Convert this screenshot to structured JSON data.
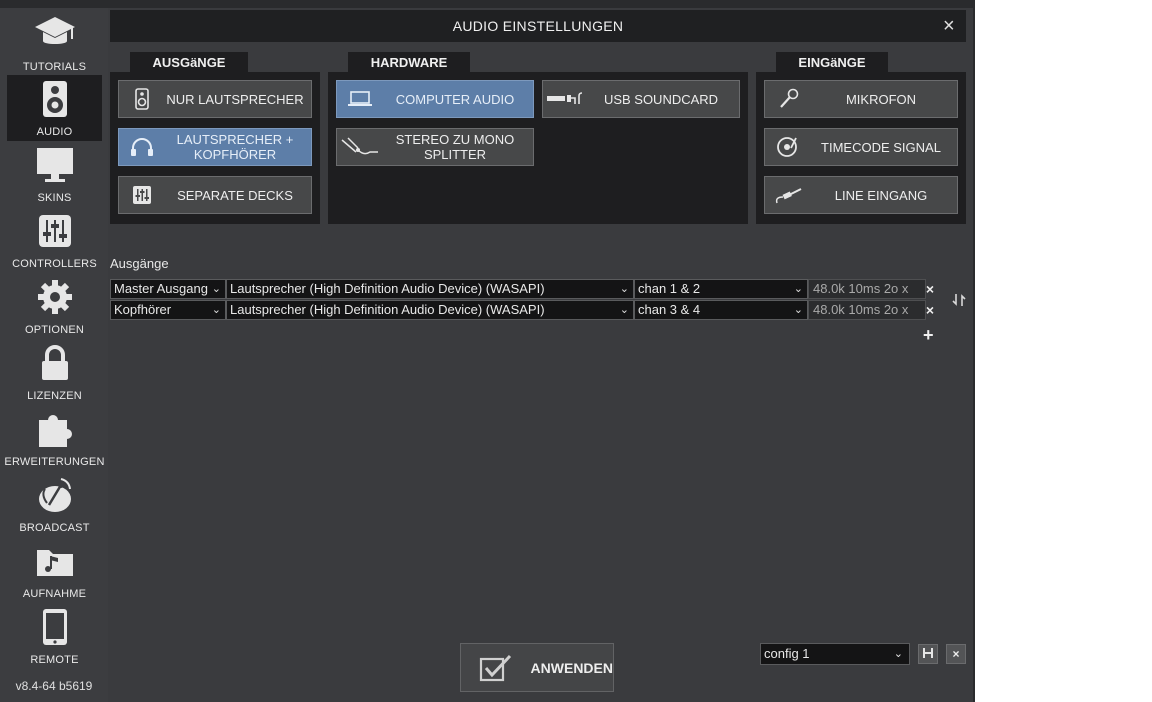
{
  "sidebar": {
    "items": [
      {
        "label": "TUTORIALS",
        "icon": "graduation-cap-icon"
      },
      {
        "label": "AUDIO",
        "icon": "speaker-icon",
        "active": true
      },
      {
        "label": "SKINS",
        "icon": "monitor-icon"
      },
      {
        "label": "CONTROLLERS",
        "icon": "sliders-icon"
      },
      {
        "label": "OPTIONEN",
        "icon": "gear-icon"
      },
      {
        "label": "LIZENZEN",
        "icon": "lock-icon"
      },
      {
        "label": "ERWEITERUNGEN",
        "icon": "puzzle-icon"
      },
      {
        "label": "BROADCAST",
        "icon": "satellite-dish-icon"
      },
      {
        "label": "AUFNAHME",
        "icon": "music-folder-icon"
      },
      {
        "label": "REMOTE",
        "icon": "phone-icon"
      }
    ],
    "version": "v8.4-64 b5619"
  },
  "dialog": {
    "title": "AUDIO EINSTELLUNGEN",
    "close": "×"
  },
  "outputs": {
    "tab": "AUSGäNGE",
    "buttons": {
      "speakers_only": "NUR LAUTSPRECHER",
      "speakers_headphones": "LAUTSPRECHER + KOPFHÖRER",
      "separate_decks": "SEPARATE DECKS"
    }
  },
  "hardware": {
    "tab": "HARDWARE",
    "buttons": {
      "computer_audio": "COMPUTER AUDIO",
      "usb_soundcard": "USB SOUNDCARD",
      "stereo_mono": "STEREO ZU MONO SPLITTER"
    }
  },
  "inputs": {
    "tab": "EINGäNGE",
    "buttons": {
      "microphone": "MIKROFON",
      "timecode": "TIMECODE SIGNAL",
      "line_in": "LINE EINGANG"
    }
  },
  "config_section": {
    "label": "Ausgänge",
    "rows": [
      {
        "output": "Master Ausgang",
        "device": "Lautsprecher (High Definition Audio Device) (WASAPI)",
        "channels": "chan 1 & 2",
        "info": "48.0k 10ms 2o x"
      },
      {
        "output": "Kopfhörer",
        "device": "Lautsprecher (High Definition Audio Device) (WASAPI)",
        "channels": "chan 3 & 4",
        "info": "48.0k 10ms 2o x"
      }
    ],
    "remove_symbol": "×",
    "add_symbol": "+"
  },
  "footer": {
    "apply": "ANWENDEN",
    "config_value": "config 1"
  },
  "colors": {
    "background": "#3a3b3e",
    "panel": "#1e1e20",
    "selected": "#5d7ea8"
  }
}
